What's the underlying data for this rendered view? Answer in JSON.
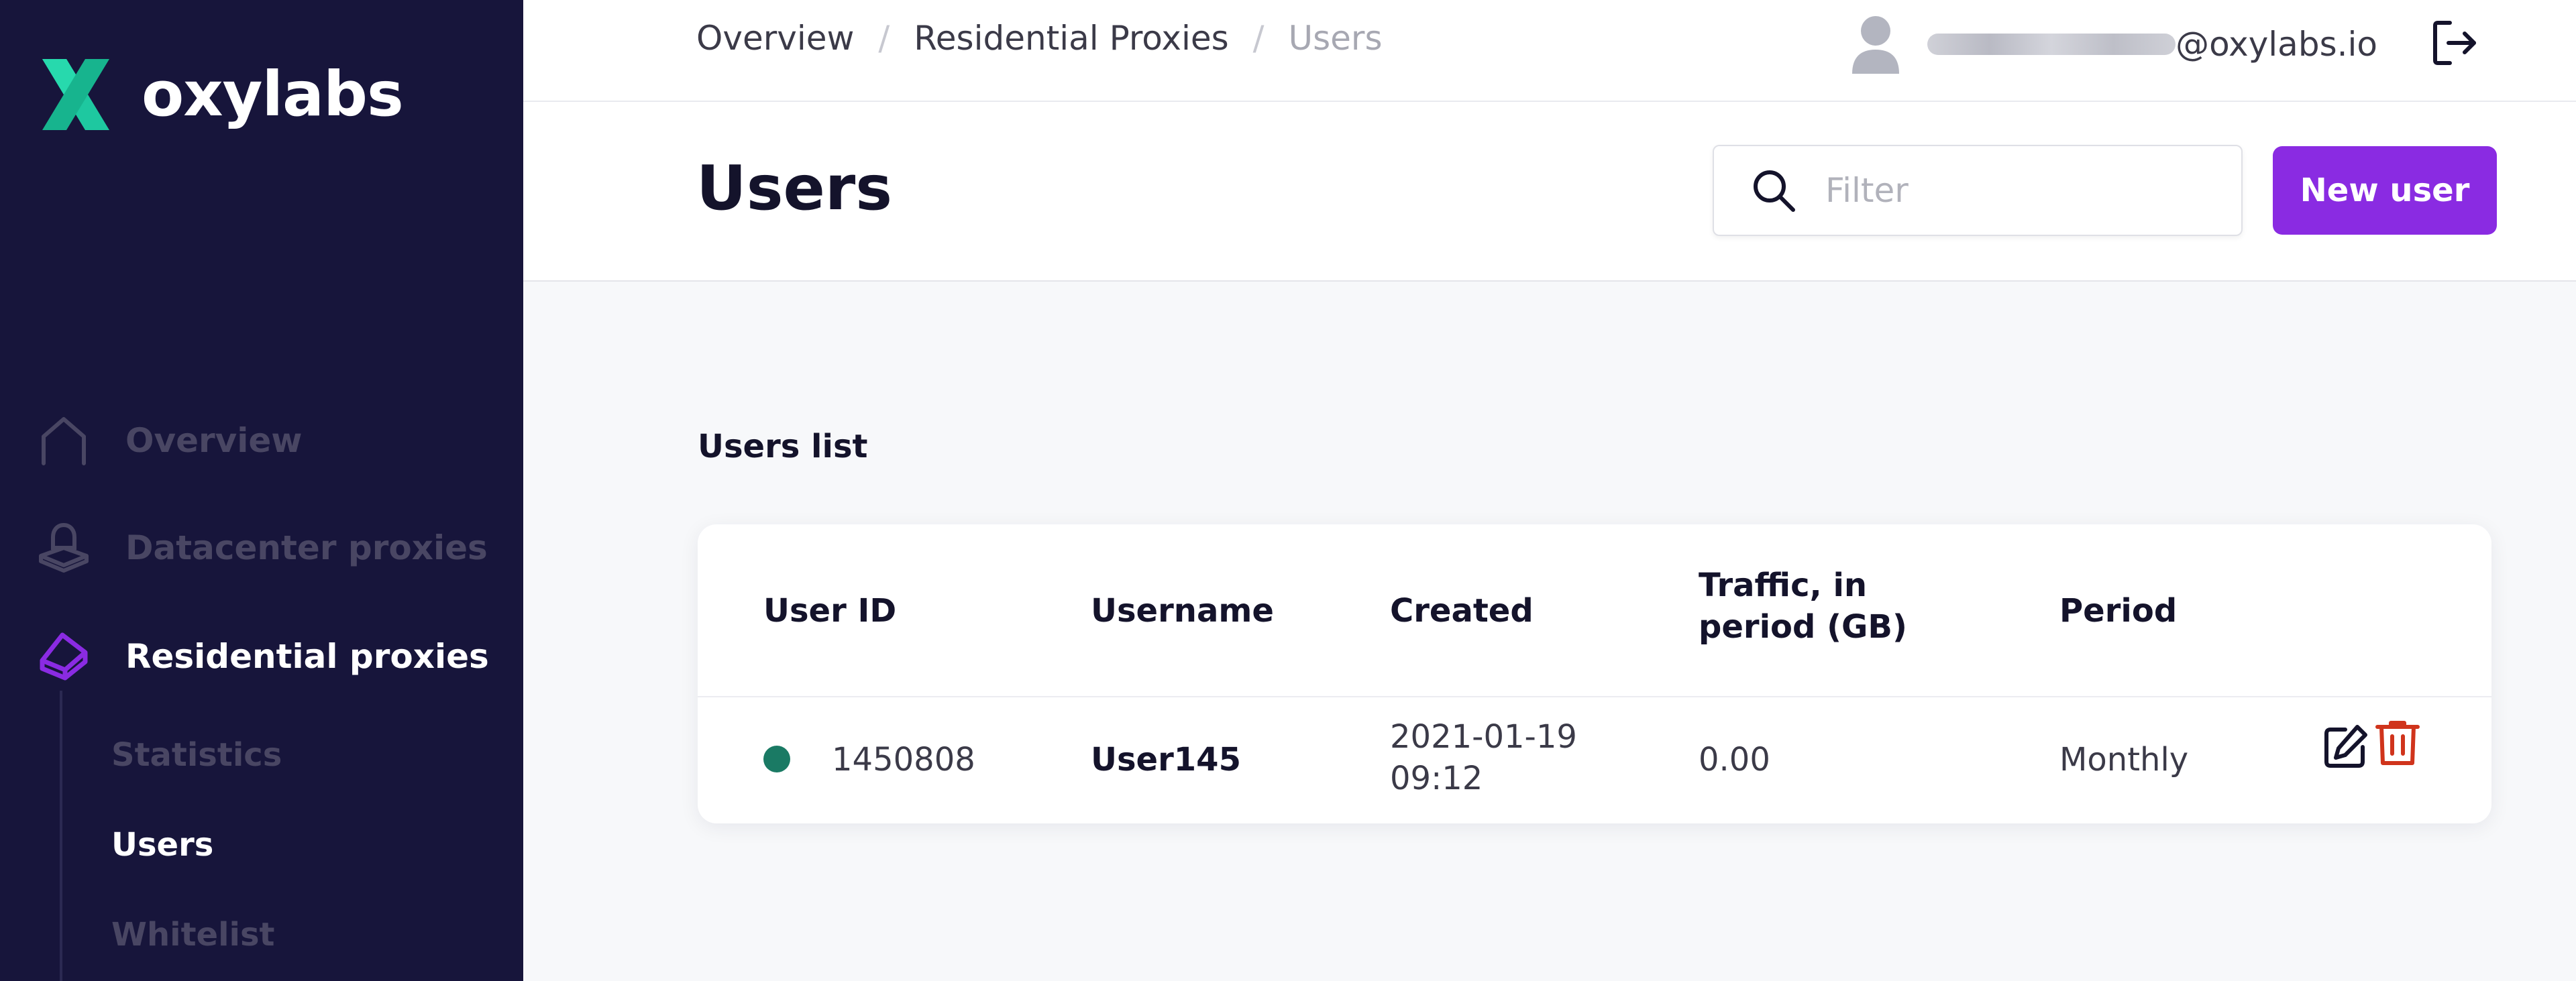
{
  "brand": {
    "name": "oxylabs",
    "accent_green": "#1ec8a0",
    "accent_purple": "#8a2be2"
  },
  "sidebar": {
    "items": [
      {
        "label": "Overview",
        "icon": "home-icon",
        "active": false
      },
      {
        "label": "Datacenter proxies",
        "icon": "datacenter-icon",
        "active": false
      },
      {
        "label": "Residential proxies",
        "icon": "residential-icon",
        "active": true
      }
    ],
    "subitems": [
      {
        "label": "Statistics",
        "active": false
      },
      {
        "label": "Users",
        "active": true
      },
      {
        "label": "Whitelist",
        "active": false
      }
    ]
  },
  "header": {
    "breadcrumb": [
      "Overview",
      "Residential Proxies",
      "Users"
    ],
    "user_email_domain": "@oxylabs.io",
    "logout_icon": "logout-icon"
  },
  "page": {
    "title": "Users",
    "filter_placeholder": "Filter",
    "new_user_label": "New user"
  },
  "users_list": {
    "title": "Users list",
    "columns": [
      "User ID",
      "Username",
      "Created",
      "Traffic, in period (GB)",
      "Period"
    ],
    "rows": [
      {
        "status_color": "#1a7a64",
        "user_id": "1450808",
        "username": "User145",
        "created_date": "2021-01-19",
        "created_time": "09:12",
        "traffic": "0.00",
        "period": "Monthly"
      }
    ]
  }
}
